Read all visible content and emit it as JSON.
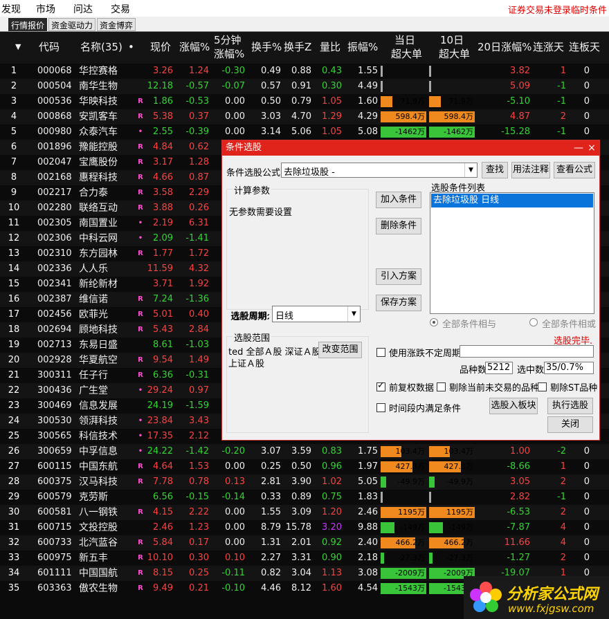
{
  "menu": [
    "发现",
    "市场",
    "问达",
    "交易"
  ],
  "menu_right": {
    "login": "证券交易未登录",
    "cond": "临时条件"
  },
  "tabs": [
    "行情报价",
    "资金驱动力",
    "资金博弈"
  ],
  "header": {
    "sort_icon": "▼",
    "code": "代码",
    "name": "名称(35)",
    "dot": "•",
    "price": "现价",
    "chg": "涨幅%",
    "m5_l1": "5分钟",
    "m5_l2": "涨幅%",
    "turn": "换手%",
    "turnz": "换手Z",
    "vr": "量比",
    "amp": "振幅%",
    "day_l1": "当日",
    "day_l2": "超大单",
    "d10_l1": "10日",
    "d10_l2": "超大单",
    "chg20": "20日涨幅%",
    "updays": "连涨天",
    "limitdays": "连板天"
  },
  "rows": [
    {
      "n": "1",
      "code": "000068",
      "name": "华控赛格",
      "r": "",
      "price": "3.26",
      "chg": "1.24",
      "m5": "-0.30",
      "turn": "0.49",
      "tz": "0.88",
      "vr": "0.43",
      "amp": "1.55",
      "d": "",
      "d_bar": 0.0,
      "d_c": "gray",
      "t": "",
      "t_bar": 0.0,
      "t_c": "gray",
      "c20": "3.82",
      "ud": "1",
      "lb": "0",
      "pc": "up",
      "cc": "up",
      "m5c": "dn",
      "vrc": "dn",
      "c20c": "up",
      "udc": "up"
    },
    {
      "n": "2",
      "code": "000504",
      "name": "南华生物",
      "r": "",
      "price": "12.18",
      "chg": "-0.57",
      "m5": "-0.07",
      "turn": "0.57",
      "tz": "0.91",
      "vr": "0.30",
      "amp": "4.49",
      "d": "",
      "d_bar": 0.0,
      "d_c": "gray",
      "t": "",
      "t_bar": 0.0,
      "t_c": "gray",
      "c20": "5.09",
      "ud": "-1",
      "lb": "0",
      "pc": "dn",
      "cc": "dn",
      "m5c": "dn",
      "vrc": "dn",
      "c20c": "up",
      "udc": "dn"
    },
    {
      "n": "3",
      "code": "000536",
      "name": "华映科技",
      "r": "R",
      "price": "1.86",
      "chg": "-0.53",
      "m5": "0.00",
      "turn": "0.50",
      "tz": "0.79",
      "vr": "1.05",
      "amp": "1.60",
      "d": "71.9万",
      "d_bar": 0.25,
      "d_c": "or",
      "t": "71.9万",
      "t_bar": 0.25,
      "t_c": "or",
      "c20": "-5.10",
      "ud": "-1",
      "lb": "0",
      "pc": "dn",
      "cc": "dn",
      "m5c": "wh",
      "vrc": "up",
      "c20c": "dn",
      "udc": "dn"
    },
    {
      "n": "4",
      "code": "000868",
      "name": "安凯客车",
      "r": "R",
      "price": "5.38",
      "chg": "0.37",
      "m5": "0.00",
      "turn": "3.03",
      "tz": "4.70",
      "vr": "1.29",
      "amp": "4.29",
      "d": "598.4万",
      "d_bar": 1.0,
      "d_c": "or",
      "t": "598.4万",
      "t_bar": 1.0,
      "t_c": "or",
      "c20": "4.87",
      "ud": "2",
      "lb": "0",
      "pc": "up",
      "cc": "up",
      "m5c": "wh",
      "vrc": "up",
      "c20c": "up",
      "udc": "up"
    },
    {
      "n": "5",
      "code": "000980",
      "name": "众泰汽车",
      "r": "•",
      "price": "2.55",
      "chg": "-0.39",
      "m5": "0.00",
      "turn": "3.14",
      "tz": "5.06",
      "vr": "1.05",
      "amp": "5.08",
      "d": "-1462万",
      "d_bar": 1.0,
      "d_c": "gr",
      "t": "-1462万",
      "t_bar": 1.0,
      "t_c": "gr",
      "c20": "-15.28",
      "ud": "-1",
      "lb": "0",
      "pc": "dn",
      "cc": "dn",
      "m5c": "wh",
      "vrc": "up",
      "c20c": "dn",
      "udc": "dn"
    },
    {
      "n": "6",
      "code": "001896",
      "name": "豫能控股",
      "r": "R",
      "price": "4.84",
      "chg": "0.62",
      "pc": "up",
      "cc": "up"
    },
    {
      "n": "7",
      "code": "002047",
      "name": "宝鹰股份",
      "r": "R",
      "price": "3.17",
      "chg": "1.28",
      "pc": "up",
      "cc": "up"
    },
    {
      "n": "8",
      "code": "002168",
      "name": "惠程科技",
      "r": "R",
      "price": "4.66",
      "chg": "0.87",
      "pc": "up",
      "cc": "up"
    },
    {
      "n": "9",
      "code": "002217",
      "name": "合力泰",
      "r": "R",
      "price": "3.58",
      "chg": "2.29",
      "pc": "up",
      "cc": "up"
    },
    {
      "n": "10",
      "code": "002280",
      "name": "联络互动",
      "r": "R",
      "price": "3.88",
      "chg": "0.26",
      "pc": "up",
      "cc": "up"
    },
    {
      "n": "11",
      "code": "002305",
      "name": "南国置业",
      "r": "•",
      "price": "2.19",
      "chg": "6.31",
      "pc": "up",
      "cc": "up"
    },
    {
      "n": "12",
      "code": "002306",
      "name": "中科云网",
      "r": "•",
      "price": "2.09",
      "chg": "-1.41",
      "pc": "dn",
      "cc": "dn"
    },
    {
      "n": "13",
      "code": "002310",
      "name": "东方园林",
      "r": "R",
      "price": "1.77",
      "chg": "1.72",
      "pc": "up",
      "cc": "up"
    },
    {
      "n": "14",
      "code": "002336",
      "name": "人人乐",
      "r": "",
      "price": "11.59",
      "chg": "4.32",
      "pc": "up",
      "cc": "up"
    },
    {
      "n": "15",
      "code": "002341",
      "name": "新纶新材",
      "r": "",
      "price": "3.71",
      "chg": "1.92",
      "pc": "up",
      "cc": "up"
    },
    {
      "n": "16",
      "code": "002387",
      "name": "维信诺",
      "r": "R",
      "price": "7.24",
      "chg": "-1.36",
      "pc": "dn",
      "cc": "dn"
    },
    {
      "n": "17",
      "code": "002456",
      "name": "欧菲光",
      "r": "R",
      "price": "5.01",
      "chg": "0.40",
      "pc": "up",
      "cc": "up"
    },
    {
      "n": "18",
      "code": "002694",
      "name": "顾地科技",
      "r": "R",
      "price": "5.43",
      "chg": "2.84",
      "pc": "up",
      "cc": "up"
    },
    {
      "n": "19",
      "code": "002713",
      "name": "东易日盛",
      "r": "",
      "price": "8.61",
      "chg": "-1.03",
      "pc": "dn",
      "cc": "dn"
    },
    {
      "n": "20",
      "code": "002928",
      "name": "华夏航空",
      "r": "R",
      "price": "9.54",
      "chg": "1.49",
      "pc": "up",
      "cc": "up"
    },
    {
      "n": "21",
      "code": "300311",
      "name": "任子行",
      "r": "R",
      "price": "6.36",
      "chg": "-0.31",
      "pc": "dn",
      "cc": "dn"
    },
    {
      "n": "22",
      "code": "300436",
      "name": "广生堂",
      "r": "•",
      "price": "29.24",
      "chg": "0.97",
      "pc": "up",
      "cc": "up"
    },
    {
      "n": "23",
      "code": "300469",
      "name": "信息发展",
      "r": "",
      "price": "24.19",
      "chg": "-1.59",
      "pc": "dn",
      "cc": "dn"
    },
    {
      "n": "24",
      "code": "300530",
      "name": "领湃科技",
      "r": "•",
      "price": "23.84",
      "chg": "3.43",
      "pc": "up",
      "cc": "up"
    },
    {
      "n": "25",
      "code": "300565",
      "name": "科信技术",
      "r": "•",
      "price": "17.35",
      "chg": "2.12",
      "pc": "up",
      "cc": "up"
    },
    {
      "n": "26",
      "code": "300659",
      "name": "中孚信息",
      "r": "•",
      "price": "24.22",
      "chg": "-1.42",
      "m5": "-0.20",
      "turn": "3.07",
      "tz": "3.59",
      "vr": "0.83",
      "amp": "1.75",
      "d": "103.4万",
      "d_bar": 0.45,
      "d_c": "or",
      "t": "103.4万",
      "t_bar": 0.45,
      "t_c": "or",
      "c20": "1.00",
      "ud": "-2",
      "lb": "0",
      "pc": "dn",
      "cc": "dn",
      "m5c": "dn",
      "vrc": "dn",
      "c20c": "up",
      "udc": "dn"
    },
    {
      "n": "27",
      "code": "600115",
      "name": "中国东航",
      "r": "R",
      "price": "4.64",
      "chg": "1.53",
      "m5": "0.00",
      "turn": "0.25",
      "tz": "0.50",
      "vr": "0.96",
      "amp": "1.97",
      "d": "427.3万",
      "d_bar": 0.7,
      "d_c": "or",
      "t": "427.3万",
      "t_bar": 0.7,
      "t_c": "or",
      "c20": "-8.66",
      "ud": "1",
      "lb": "0",
      "pc": "up",
      "cc": "up",
      "m5c": "wh",
      "vrc": "dn",
      "c20c": "dn",
      "udc": "up"
    },
    {
      "n": "28",
      "code": "600375",
      "name": "汉马科技",
      "r": "R",
      "price": "7.78",
      "chg": "0.78",
      "m5": "0.13",
      "turn": "2.81",
      "tz": "3.90",
      "vr": "1.02",
      "amp": "5.05",
      "d": "-49.9万",
      "d_bar": 0.12,
      "d_c": "gr",
      "t": "-49.9万",
      "t_bar": 0.12,
      "t_c": "gr",
      "c20": "3.05",
      "ud": "2",
      "lb": "0",
      "pc": "up",
      "cc": "up",
      "m5c": "up",
      "vrc": "up",
      "c20c": "up",
      "udc": "up"
    },
    {
      "n": "29",
      "code": "600579",
      "name": "克劳斯",
      "r": "",
      "price": "6.56",
      "chg": "-0.15",
      "m5": "-0.14",
      "turn": "0.33",
      "tz": "0.89",
      "vr": "0.75",
      "amp": "1.83",
      "d": "",
      "d_bar": 0.0,
      "d_c": "gray",
      "t": "",
      "t_bar": 0.0,
      "t_c": "gray",
      "c20": "2.82",
      "ud": "-1",
      "lb": "0",
      "pc": "dn",
      "cc": "dn",
      "m5c": "dn",
      "vrc": "dn",
      "c20c": "up",
      "udc": "dn"
    },
    {
      "n": "30",
      "code": "600581",
      "name": "八一钢铁",
      "r": "R",
      "price": "4.15",
      "chg": "2.22",
      "m5": "0.00",
      "turn": "1.55",
      "tz": "3.09",
      "vr": "1.20",
      "amp": "2.46",
      "d": "1195万",
      "d_bar": 1.0,
      "d_c": "or",
      "t": "1195万",
      "t_bar": 1.0,
      "t_c": "or",
      "c20": "-6.53",
      "ud": "2",
      "lb": "0",
      "pc": "up",
      "cc": "up",
      "m5c": "wh",
      "vrc": "up",
      "c20c": "dn",
      "udc": "up"
    },
    {
      "n": "31",
      "code": "600715",
      "name": "文投控股",
      "r": "",
      "price": "2.46",
      "chg": "1.23",
      "m5": "0.00",
      "turn": "8.79",
      "tz": "15.78",
      "vr": "3.20",
      "amp": "9.88",
      "d": "-149万",
      "d_bar": 0.3,
      "d_c": "gr",
      "t": "-149万",
      "t_bar": 0.3,
      "t_c": "gr",
      "c20": "-7.87",
      "ud": "4",
      "lb": "0",
      "pc": "up",
      "cc": "up",
      "m5c": "wh",
      "vrc": "pu",
      "c20c": "dn",
      "udc": "up"
    },
    {
      "n": "32",
      "code": "600733",
      "name": "北汽蓝谷",
      "r": "R",
      "price": "5.84",
      "chg": "0.17",
      "m5": "0.00",
      "turn": "1.31",
      "tz": "2.01",
      "vr": "0.92",
      "amp": "2.40",
      "d": "466.2万",
      "d_bar": 0.75,
      "d_c": "or",
      "t": "466.2万",
      "t_bar": 0.75,
      "t_c": "or",
      "c20": "11.66",
      "ud": "4",
      "lb": "0",
      "pc": "up",
      "cc": "up",
      "m5c": "wh",
      "vrc": "dn",
      "c20c": "up",
      "udc": "up"
    },
    {
      "n": "33",
      "code": "600975",
      "name": "新五丰",
      "r": "R",
      "price": "10.10",
      "chg": "0.30",
      "m5": "0.10",
      "turn": "2.27",
      "tz": "3.31",
      "vr": "0.90",
      "amp": "2.18",
      "d": "-27.3万",
      "d_bar": 0.08,
      "d_c": "gr",
      "t": "-27.3万",
      "t_bar": 0.08,
      "t_c": "gr",
      "c20": "-1.27",
      "ud": "2",
      "lb": "0",
      "pc": "up",
      "cc": "up",
      "m5c": "up",
      "vrc": "dn",
      "c20c": "dn",
      "udc": "up"
    },
    {
      "n": "34",
      "code": "601111",
      "name": "中国国航",
      "r": "R",
      "price": "8.15",
      "chg": "0.25",
      "m5": "-0.11",
      "turn": "0.82",
      "tz": "3.04",
      "vr": "1.13",
      "amp": "3.08",
      "d": "-2009万",
      "d_bar": 1.0,
      "d_c": "gr",
      "t": "-2009万",
      "t_bar": 1.0,
      "t_c": "gr",
      "c20": "-19.07",
      "ud": "1",
      "lb": "0",
      "pc": "up",
      "cc": "up",
      "m5c": "dn",
      "vrc": "up",
      "c20c": "dn",
      "udc": "up"
    },
    {
      "n": "35",
      "code": "603363",
      "name": "傲农生物",
      "r": "R",
      "price": "9.49",
      "chg": "0.21",
      "m5": "-0.10",
      "turn": "4.46",
      "tz": "8.12",
      "vr": "1.60",
      "amp": "4.54",
      "d": "-1543万",
      "d_bar": 1.0,
      "d_c": "gr",
      "t": "-1543万",
      "t_bar": 1.0,
      "t_c": "gr",
      "c20": "",
      "ud": "",
      "lb": "",
      "pc": "up",
      "cc": "up",
      "m5c": "dn",
      "vrc": "up",
      "c20c": "dn",
      "udc": "up"
    }
  ],
  "dialog": {
    "title": "条件选股",
    "min_icon": "—",
    "close_icon": "×",
    "formula_label": "条件选股公式",
    "formula_value": "去除垃圾股   -",
    "btn_find": "查找",
    "btn_usage": "用法注释",
    "btn_view": "查看公式",
    "params_group": "计算参数",
    "params_text": "无参数需要设置",
    "btn_add": "加入条件",
    "btn_del": "删除条件",
    "btn_import": "引入方案",
    "btn_save": "保存方案",
    "list_label": "选股条件列表",
    "list_item": "去除垃圾股  日线",
    "period_label": "选股周期:",
    "period_value": "日线",
    "radio_and": "全部条件相与",
    "radio_or": "全部条件相或",
    "range_group": "选股范围",
    "range_text1": "ted 全部Ａ股 深证Ａ股",
    "range_text2": "上证Ａ股",
    "btn_range": "改变范围",
    "status": "选股完毕.",
    "chk_period": "使用涨跌不定周期",
    "count_label": "品种数",
    "count_value": "5212",
    "hit_label": "选中数",
    "hit_value": "35/0.7%",
    "chk_prefq": "前复权数据",
    "chk_notrade": "剔除当前未交易的品种",
    "chk_st": "剔除ST品种",
    "chk_time": "时间段内满足条件",
    "btn_toblock": "选股入板块",
    "btn_run": "执行选股",
    "btn_close": "关闭"
  },
  "watermark": "分析家公式网www.fxjgsw.com",
  "logo": {
    "cn": "分析家公式网",
    "url": "www.fxjgsw.com"
  },
  "colors": {
    "up": "#ff4040",
    "down": "#2ed82e",
    "bar_orange": "#f08a1e",
    "bar_green": "#39c439",
    "dialog_title": "#e0241b"
  }
}
